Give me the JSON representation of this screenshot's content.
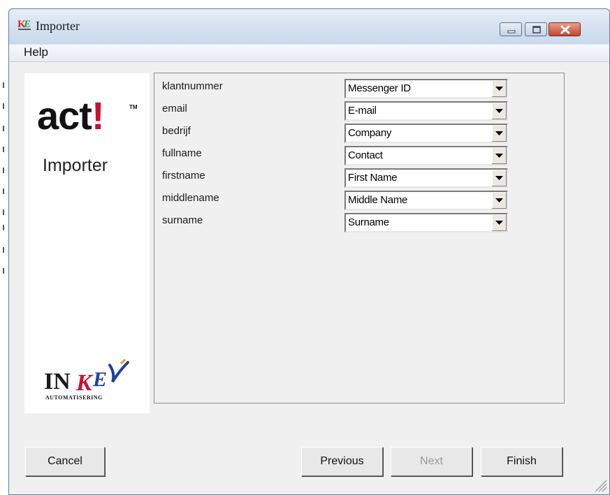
{
  "window": {
    "title": "Importer",
    "icon": "ke-app-icon",
    "controls": [
      "minimize-icon",
      "maximize-icon",
      "close-icon"
    ]
  },
  "menu": {
    "items": [
      "Help"
    ]
  },
  "branding": {
    "product": "act",
    "product_mark": "!",
    "trademark": "TM",
    "subtitle": "Importer",
    "company_logo": "INKEY",
    "company_tagline": "AUTOMATISERING"
  },
  "fields": [
    {
      "label": "klantnummer",
      "mapping": "Messenger ID"
    },
    {
      "label": "email",
      "mapping": "E-mail"
    },
    {
      "label": "bedrijf",
      "mapping": "Company"
    },
    {
      "label": "fullname",
      "mapping": "Contact"
    },
    {
      "label": "firstname",
      "mapping": "First Name"
    },
    {
      "label": "middlename",
      "mapping": "Middle Name"
    },
    {
      "label": "surname",
      "mapping": "Surname"
    }
  ],
  "buttons": {
    "cancel": "Cancel",
    "previous": "Previous",
    "next": "Next",
    "finish": "Finish"
  },
  "colors": {
    "act_red": "#c8102e",
    "window_frame": "#dbe4ef"
  }
}
